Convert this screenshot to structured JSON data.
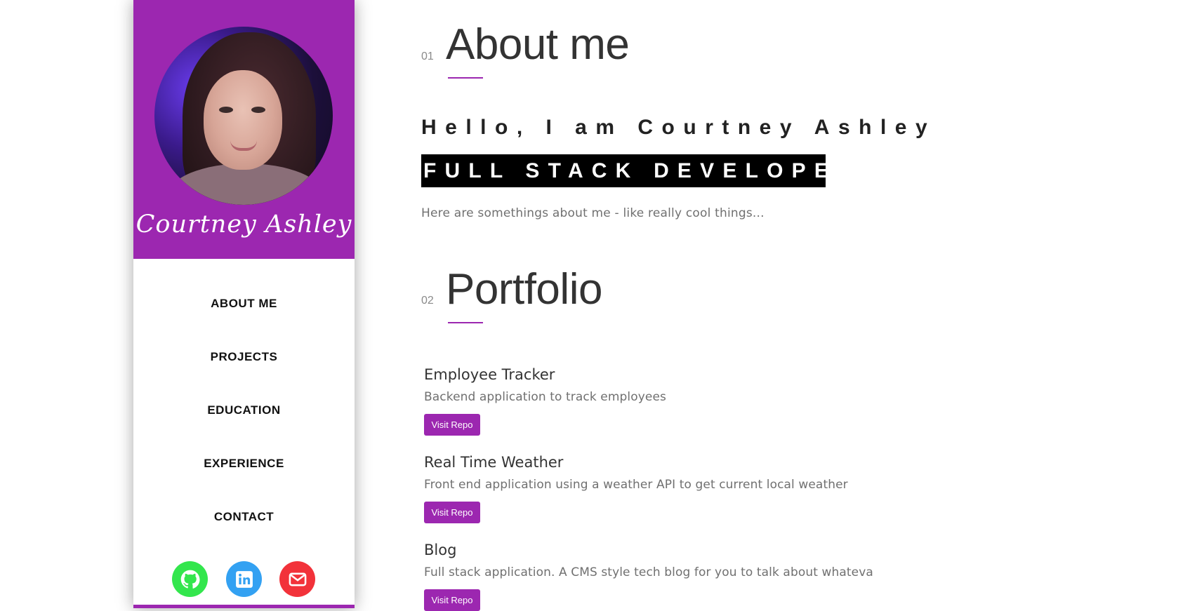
{
  "sidebar": {
    "name_signature": "Courtney Ashley",
    "nav": [
      "ABOUT ME",
      "PROJECTS",
      "EDUCATION",
      "EXPERIENCE",
      "CONTACT"
    ],
    "socials": [
      {
        "icon": "github-icon",
        "color": "#33e64d"
      },
      {
        "icon": "linkedin-icon",
        "color": "#33a1f2"
      },
      {
        "icon": "email-icon",
        "color": "#f2323a"
      }
    ]
  },
  "about": {
    "number": "01",
    "title": "About me",
    "hello": "Hello, I am Courtney Ashley",
    "role": "FULL STACK DEVELOPER",
    "intro": "Here are somethings about me - like really cool things..."
  },
  "portfolio": {
    "number": "02",
    "title": "Portfolio",
    "projects": [
      {
        "title": "Employee Tracker",
        "description": "Backend application to track employees",
        "button": "Visit Repo"
      },
      {
        "title": "Real Time Weather",
        "description": "Front end application using a weather API to get current local weather",
        "button": "Visit Repo"
      },
      {
        "title": "Blog",
        "description": "Full stack application. A CMS style tech blog for you to talk about whateva",
        "button": "Visit Repo"
      }
    ]
  },
  "colors": {
    "accent": "#9c27b0",
    "role_bg": "#000000"
  }
}
